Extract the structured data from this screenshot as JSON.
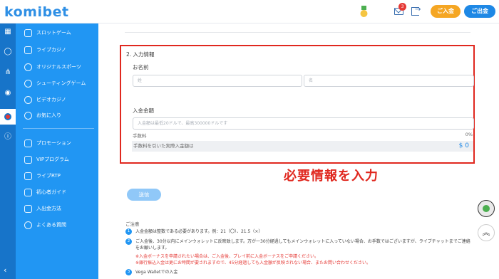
{
  "header": {
    "logo": "komibet",
    "mail_badge": "3",
    "deposit_label": "ご入金",
    "withdraw_label": "ご出金"
  },
  "sidebar": {
    "items": [
      {
        "label": "スロットゲーム",
        "icon": "slot-icon"
      },
      {
        "label": "ライブカジノ",
        "icon": "live-casino-icon"
      },
      {
        "label": "オリジナルスポーツ",
        "icon": "sports-icon"
      },
      {
        "label": "シューティングゲーム",
        "icon": "shooting-icon"
      },
      {
        "label": "ビデオカジノ",
        "icon": "video-casino-icon"
      },
      {
        "label": "お気に入り",
        "icon": "favorite-icon"
      },
      {
        "label": "プロモーション",
        "icon": "promotion-icon"
      },
      {
        "label": "VIPプログラム",
        "icon": "vip-icon"
      },
      {
        "label": "ライブRTP",
        "icon": "rtp-icon"
      },
      {
        "label": "初心者ガイド",
        "icon": "guide-icon"
      },
      {
        "label": "入出金方法",
        "icon": "payment-icon"
      },
      {
        "label": "よくある質問",
        "icon": "faq-icon"
      }
    ]
  },
  "form": {
    "section_title": "2. 入力情報",
    "name_label": "お名前",
    "last_name_placeholder": "姓",
    "first_name_placeholder": "名",
    "amount_label": "入金金額",
    "amount_placeholder": "入金額は最低20ドルで、最高300000ドルです",
    "fee_label": "手数料",
    "fee_value": "0%",
    "net_label": "手数料を引いた実際入金額は",
    "net_value": "$ 0",
    "submit_label": "送信"
  },
  "annotation": "必要情報を入力",
  "notes": {
    "title": "ご注意",
    "items": [
      {
        "num": "1",
        "text": "入金金額は整数である必要があります。例：21（〇）、21.5（×）"
      },
      {
        "num": "2",
        "text": "ご入金後、30分以内にメインウォレットに反映致します。万が一30分経過してもメインウォレットに入っていない場合、お手数ではございますが、ライブチャットまでご連絡をお願いします。"
      },
      {
        "num": "3",
        "text": "Vega Walletでの入金"
      }
    ],
    "warnings": [
      "※入金ボーナスを申請されたい場合は、ご入金後、プレイ前に入金ボーナスをご申請ください。",
      "※銀行振込入金は更にお時間が要されますので、45分経過しても入金額が反映されない場合、またお問い合わせください。"
    ]
  },
  "colors": {
    "sidebar": "#2196f3",
    "rail": "#1774c9",
    "highlight": "#e0281f",
    "deposit": "#f5a623",
    "withdraw": "#1e88e5"
  }
}
